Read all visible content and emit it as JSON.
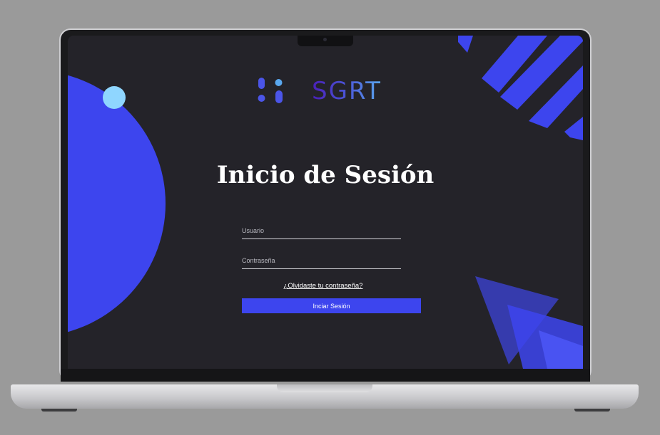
{
  "app": {
    "logo_text": "SGRT"
  },
  "login": {
    "title": "Inicio de Sesión",
    "username_placeholder": "Usuario",
    "password_placeholder": "Contraseña",
    "forgot_link": "¿Olvidaste tu contraseña?",
    "submit_label": "Inciar Sesión"
  },
  "colors": {
    "background": "#242329",
    "accent_blue": "#3d45ee",
    "light_cyan": "#8fd6ff",
    "logo_gradient": [
      "#4a1fb8",
      "#5aa8ee"
    ]
  },
  "icons": {
    "logo_mark": "sgrt-logo-icon"
  }
}
